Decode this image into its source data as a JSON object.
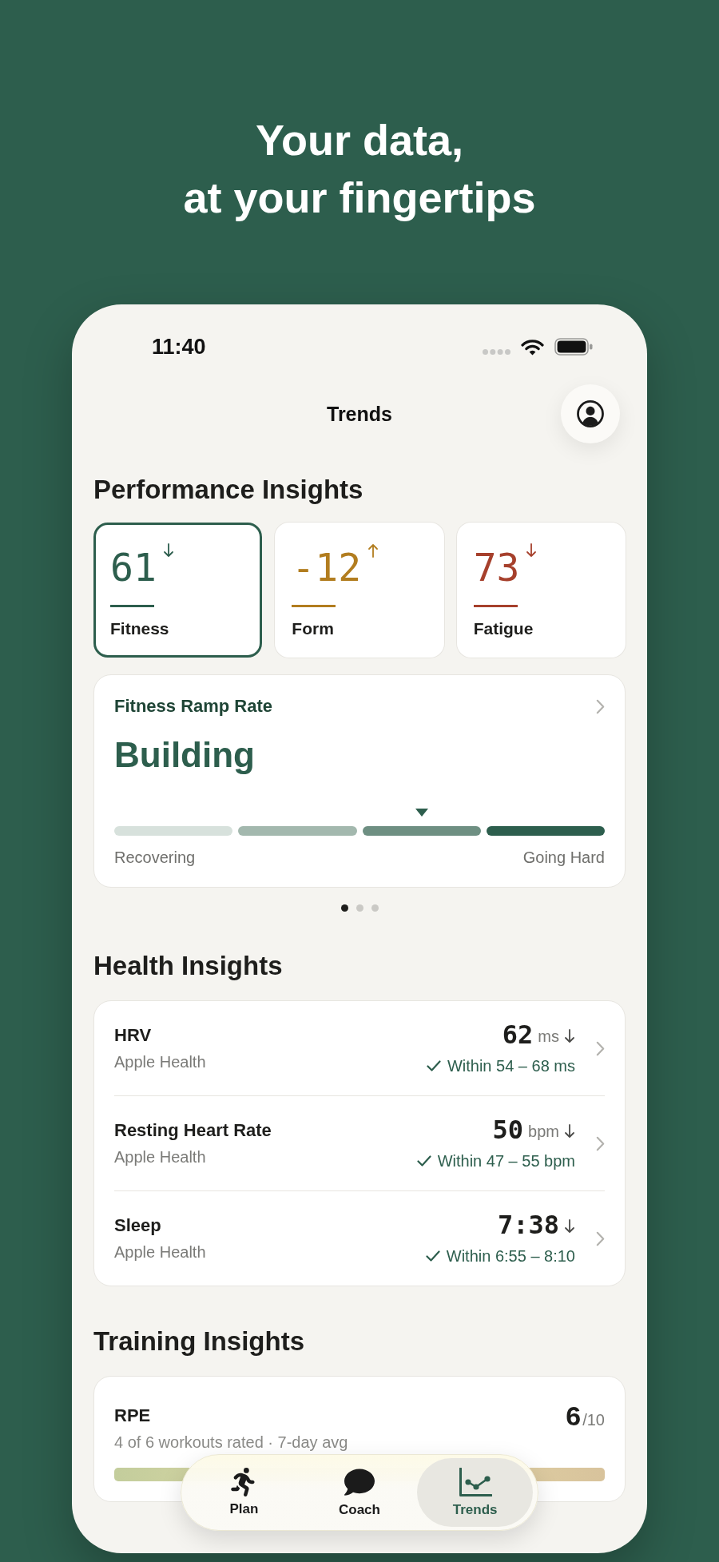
{
  "headline": [
    "Your data,",
    "at your fingertips"
  ],
  "status_bar": {
    "time": "11:40"
  },
  "nav": {
    "title": "Trends"
  },
  "performance": {
    "title": "Performance Insights",
    "metrics": [
      {
        "value": "61",
        "rising": false,
        "label": "Fitness",
        "color": "#2d5e4d",
        "selected": true
      },
      {
        "value": "-12",
        "rising": true,
        "label": "Form",
        "color": "#b27d1f",
        "selected": false
      },
      {
        "value": "73",
        "rising": false,
        "label": "Fatigue",
        "color": "#a6402c",
        "selected": false
      }
    ]
  },
  "ramp_rate": {
    "title": "Fitness Ramp Rate",
    "status": "Building",
    "segments": [
      {
        "color": "#d7e1dc",
        "selected": false
      },
      {
        "color": "#a3b8ae",
        "selected": false
      },
      {
        "color": "#6e8f82",
        "selected": true
      },
      {
        "color": "#2d5e4d",
        "selected": false
      }
    ],
    "min_label": "Recovering",
    "max_label": "Going Hard"
  },
  "pager": {
    "dots": [
      {
        "selected": true
      },
      {
        "selected": false
      },
      {
        "selected": false
      }
    ]
  },
  "health": {
    "title": "Health Insights",
    "rows": [
      {
        "name": "HRV",
        "source": "Apple Health",
        "value": "62",
        "unit": "ms",
        "rising": false,
        "in_range": true,
        "range": "Within 54 – 68 ms"
      },
      {
        "name": "Resting Heart Rate",
        "source": "Apple Health",
        "value": "50",
        "unit": "bpm",
        "rising": false,
        "in_range": true,
        "range": "Within 47 – 55 bpm"
      },
      {
        "name": "Sleep",
        "source": "Apple Health",
        "value": "7:38",
        "rising": false,
        "in_range": true,
        "range": "Within 6:55 – 8:10"
      }
    ]
  },
  "training": {
    "title": "Training Insights",
    "cards": [
      {
        "name": "RPE",
        "subtitle": "4 of 6 workouts rated · 7-day avg",
        "value": "6",
        "scale": "/10"
      }
    ]
  },
  "tab_bar": {
    "tabs": [
      {
        "label": "Plan",
        "selected": false
      },
      {
        "label": "Coach",
        "selected": false
      },
      {
        "label": "Trends",
        "selected": true
      }
    ]
  }
}
